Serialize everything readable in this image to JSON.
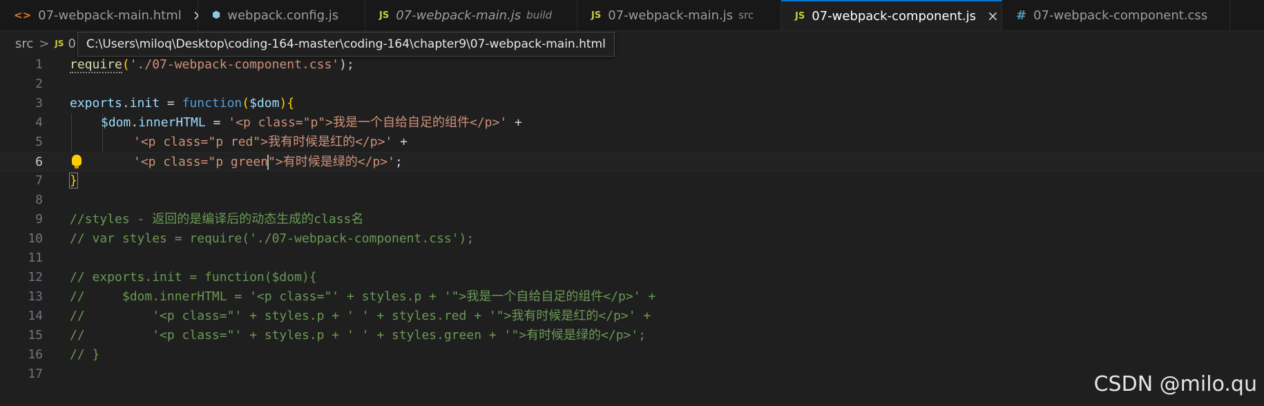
{
  "tabs": [
    {
      "icon": "<>",
      "title": "07-webpack-main.html",
      "desc": "",
      "close": "×"
    },
    {
      "icon": "⬢",
      "title": "webpack.config.js",
      "desc": ""
    },
    {
      "icon": "JS",
      "title": "07-webpack-main.js",
      "desc": "build"
    },
    {
      "icon": "JS",
      "title": "07-webpack-main.js",
      "desc": "src"
    },
    {
      "icon": "JS",
      "title": "07-webpack-component.js",
      "desc": "",
      "close": "×"
    },
    {
      "icon": "#",
      "title": "07-webpack-component.css",
      "desc": ""
    }
  ],
  "breadcrumb": {
    "root": "src",
    "sep": ">",
    "file_icon": "JS",
    "file_initial": "0"
  },
  "tooltip": "C:\\Users\\miloq\\Desktop\\coding-164-master\\coding-164\\chapter9\\07-webpack-main.html",
  "code": {
    "l1": {
      "n": "1",
      "a": "require",
      "b": "(",
      "c": "'./07-webpack-component.css'",
      "d": ");"
    },
    "l2": {
      "n": "2"
    },
    "l3": {
      "n": "3",
      "a": "exports",
      "b": ".",
      "c": "init",
      "d": " = ",
      "e": "function",
      "f": "(",
      "g": "$dom",
      "h": ")",
      "i": "{"
    },
    "l4": {
      "n": "4",
      "a": "$dom",
      "b": ".",
      "c": "innerHTML",
      "d": " = ",
      "e": "'<p class=\"p\">我是一个自给自足的组件</p>'",
      "f": " +"
    },
    "l5": {
      "n": "5",
      "a": "'<p class=\"p red\">我有时候是红的</p>'",
      "b": " +"
    },
    "l6": {
      "n": "6",
      "a": "'<p class=\"p green",
      "b": "\">有时候是绿的</p>'",
      "c": ";"
    },
    "l7": {
      "n": "7",
      "a": "}"
    },
    "l8": {
      "n": "8"
    },
    "l9": {
      "n": "9",
      "a": "//styles - 返回的是编译后的动态生成的class名"
    },
    "l10": {
      "n": "10",
      "a": "// var styles = require('./07-webpack-component.css');"
    },
    "l11": {
      "n": "11"
    },
    "l12": {
      "n": "12",
      "a": "// exports.init = function($dom){"
    },
    "l13": {
      "n": "13",
      "a": "//     $dom.innerHTML = '<p class=\"' + styles.p + '\">我是一个自给自足的组件</p>' +"
    },
    "l14": {
      "n": "14",
      "a": "//         '<p class=\"' + styles.p + ' ' + styles.red + '\">我有时候是红的</p>' +"
    },
    "l15": {
      "n": "15",
      "a": "//         '<p class=\"' + styles.p + ' ' + styles.green + '\">有时候是绿的</p>';"
    },
    "l16": {
      "n": "16",
      "a": "// }"
    },
    "l17": {
      "n": "17"
    }
  },
  "watermark": "CSDN @milo.qu"
}
